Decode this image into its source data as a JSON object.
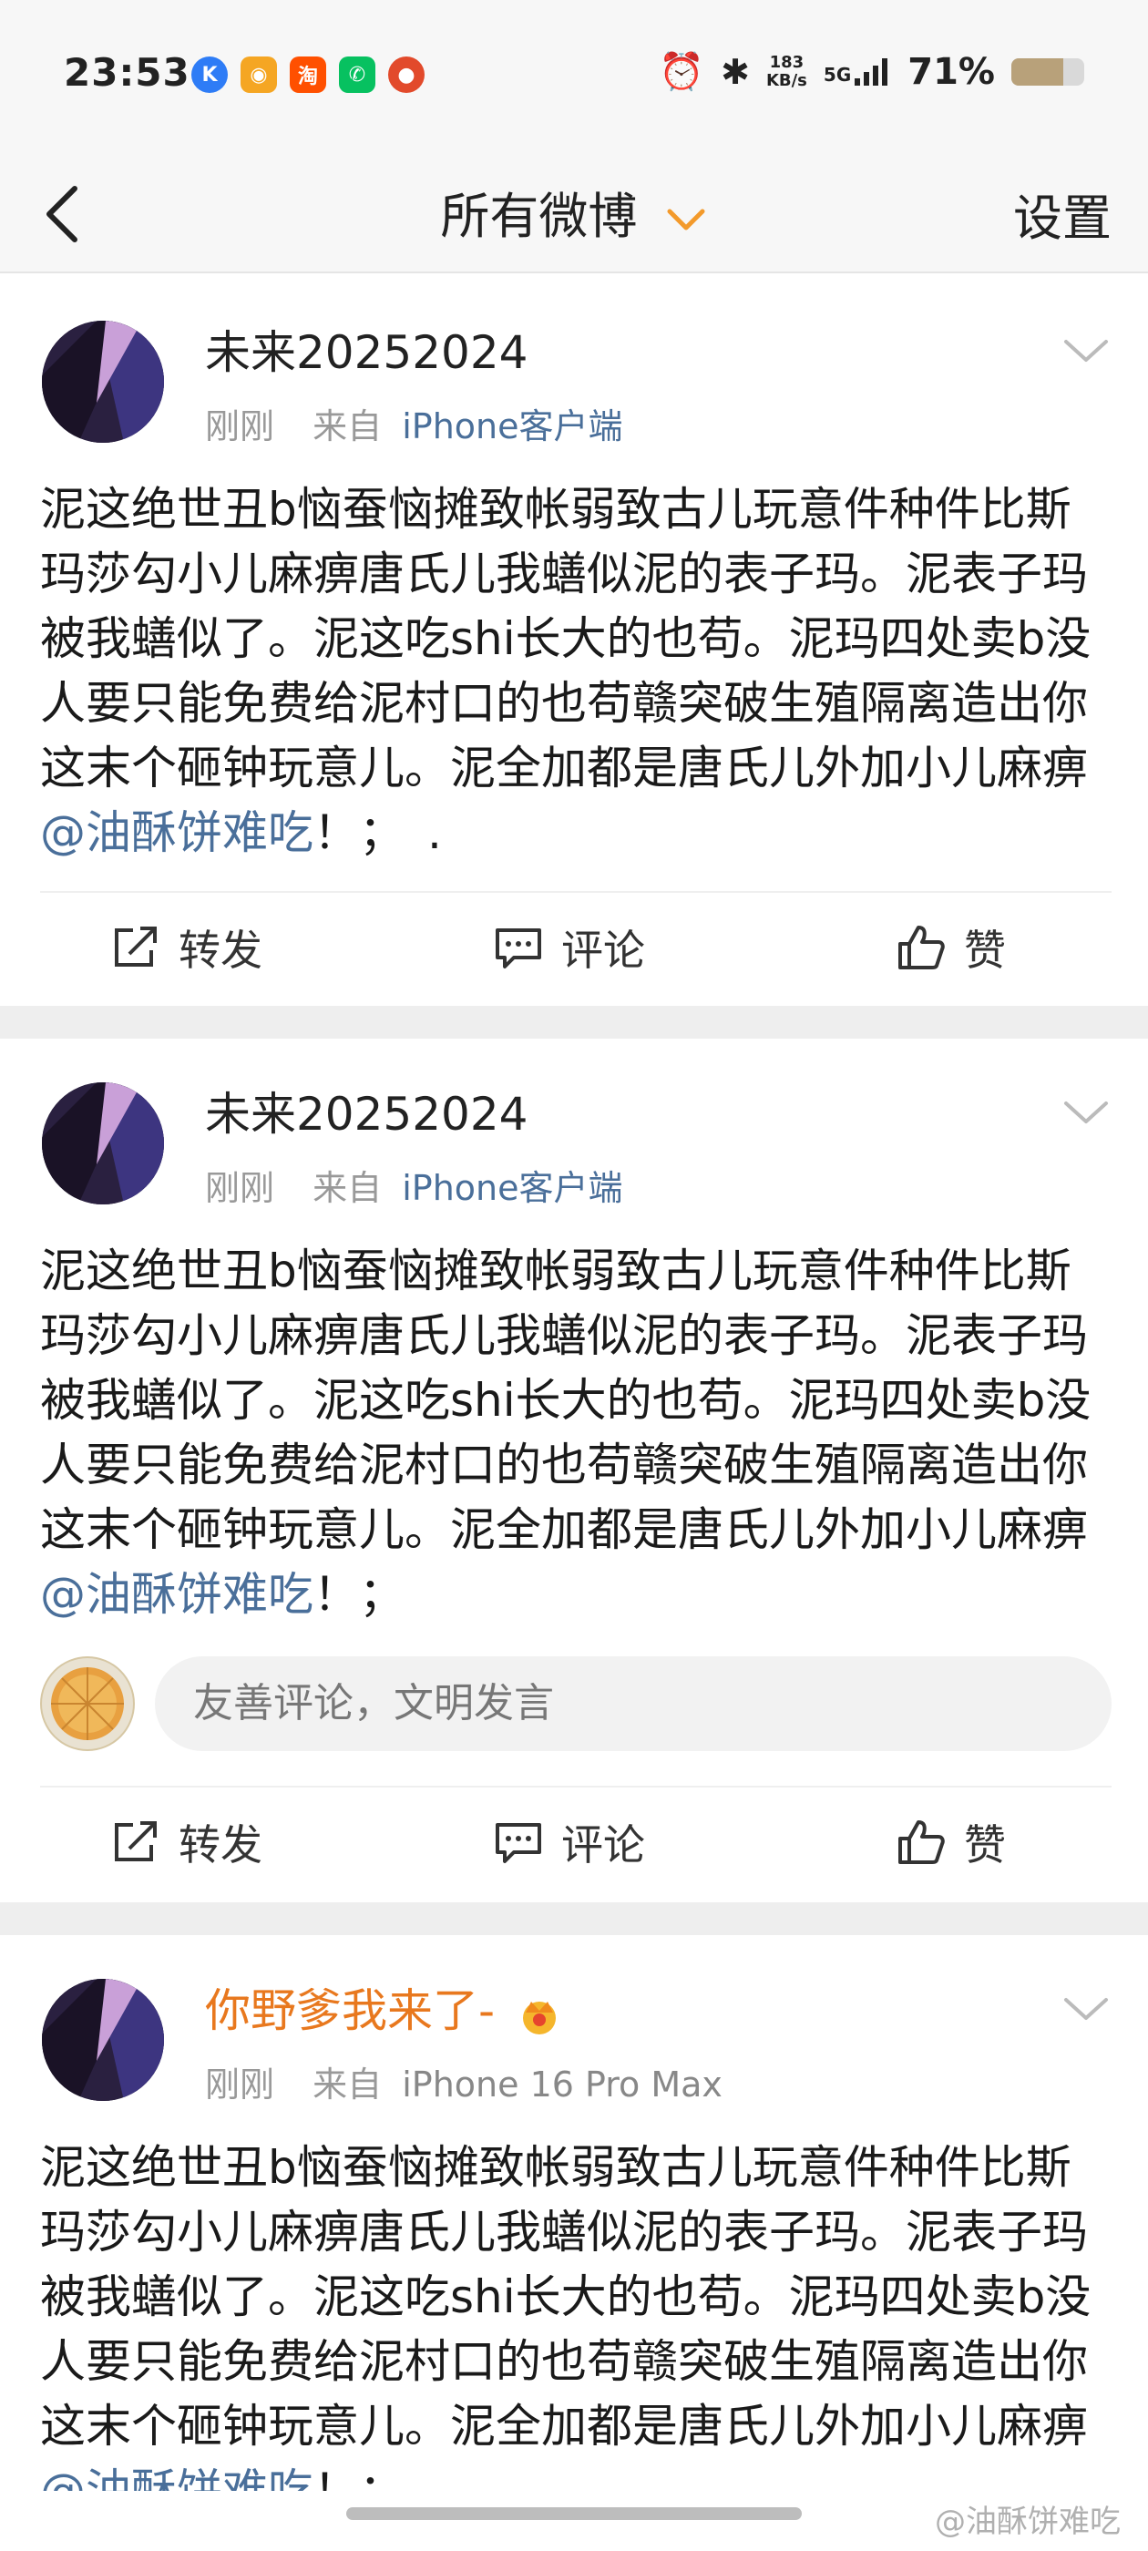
{
  "status_bar": {
    "time": "23:53",
    "apps": [
      {
        "icon": "k-app-icon",
        "glyph": "K",
        "color": "#2e7cf6"
      },
      {
        "icon": "weibo-icon",
        "glyph": "◉",
        "color": "#f5a623"
      },
      {
        "icon": "taobao-icon",
        "glyph": "淘",
        "color": "#ff5000"
      },
      {
        "icon": "wechat-icon",
        "glyph": "✆",
        "color": "#07c160"
      },
      {
        "icon": "game-icon",
        "glyph": "●",
        "color": "#e24a2b"
      }
    ],
    "net_speed_value": "183",
    "net_speed_unit": "KB/s",
    "network": "5G",
    "battery": "71%",
    "battery_level": 0.71
  },
  "nav": {
    "title": "所有微博",
    "settings": "设置"
  },
  "posts": [
    {
      "username": "未来20252024",
      "time": "刚刚",
      "source_prefix": "来自",
      "source": "iPhone客户端",
      "body": "泥这绝世丑b恼蚕恼摊致帐弱致古儿玩意件种件比斯玛莎勾小儿麻痹唐氏儿我蟮似泥的表子玛。泥表子玛被我蟮似了。泥这吃shi长大的也苟。泥玛四处卖b没人要只能免费给泥村口的也苟赣突破生殖隔离造出你这末个砸钟玩意儿。泥全加都是唐氏儿外加小儿麻痹",
      "mention": "@油酥饼难吃",
      "tail": "！；　.",
      "actions": {
        "repost": "转发",
        "comment": "评论",
        "like": "赞"
      }
    },
    {
      "username": "未来20252024",
      "time": "刚刚",
      "source_prefix": "来自",
      "source": "iPhone客户端",
      "body": "泥这绝世丑b恼蚕恼摊致帐弱致古儿玩意件种件比斯玛莎勾小儿麻痹唐氏儿我蟮似泥的表子玛。泥表子玛被我蟮似了。泥这吃shi长大的也苟。泥玛四处卖b没人要只能免费给泥村口的也苟赣突破生殖隔离造出你这末个砸钟玩意儿。泥全加都是唐氏儿外加小儿麻痹",
      "mention": "@油酥饼难吃",
      "tail": "！；",
      "comment_placeholder": "友善评论，文明发言",
      "actions": {
        "repost": "转发",
        "comment": "评论",
        "like": "赞"
      }
    },
    {
      "username": "你野爹我来了-",
      "time": "刚刚",
      "source_prefix": "来自",
      "source": "iPhone 16 Pro Max",
      "body": "泥这绝世丑b恼蚕恼摊致帐弱致古儿玩意件种件比斯玛莎勾小儿麻痹唐氏儿我蟮似泥的表子玛。泥表子玛被我蟮似了。泥这吃shi长大的也苟。泥玛四处卖b没人要只能免费给泥村口的也苟赣突破生殖隔离造出你这末个砸钟玩意儿。泥全加都是唐氏儿外加小儿麻痹",
      "mention": "@油酥饼难吃",
      "tail": "！；"
    }
  ],
  "watermark": "@油酥饼难吃"
}
